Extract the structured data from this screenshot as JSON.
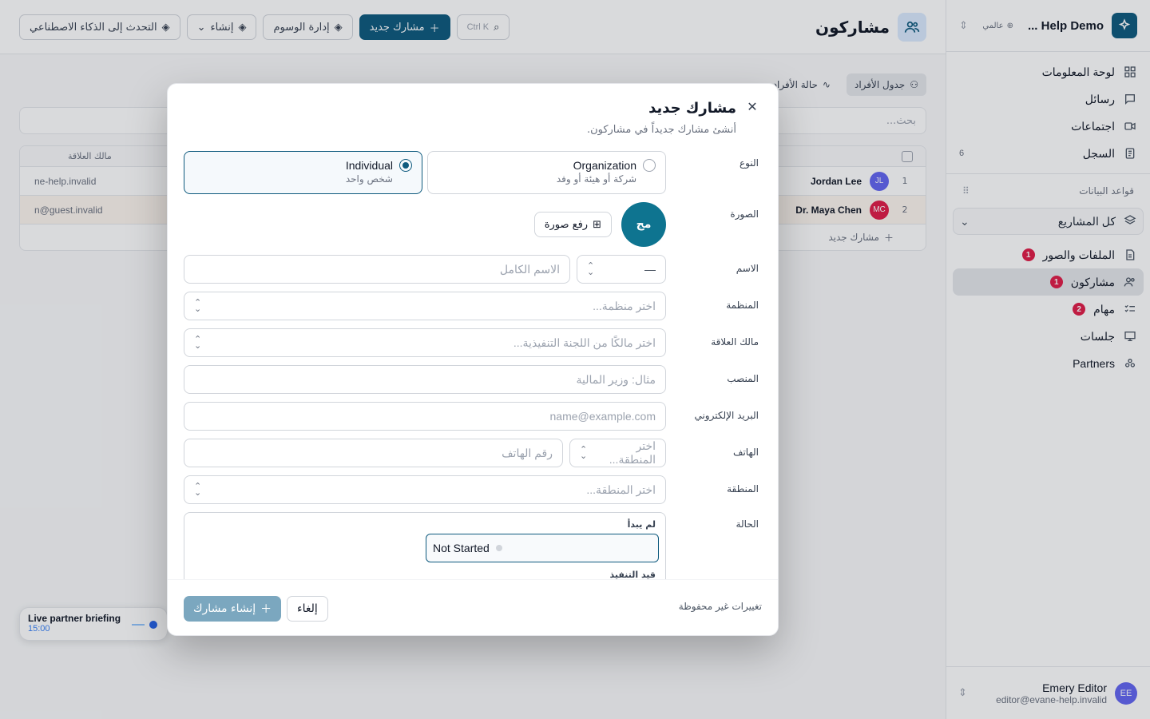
{
  "sidebar": {
    "workspace_name": "Help Demo ...",
    "workspace_scope": "عالمي",
    "nav": [
      {
        "label": "لوحة المعلومات",
        "icon": "dashboard-icon"
      },
      {
        "label": "رسائل",
        "icon": "chat-icon"
      },
      {
        "label": "اجتماعات",
        "icon": "video-icon"
      },
      {
        "label": "السجل",
        "icon": "log-icon",
        "count": "6"
      }
    ],
    "databases_title": "قواعد البيانات",
    "project_selector": "كل المشاريع",
    "db_items": [
      {
        "label": "الملفات والصور",
        "badge": "1"
      },
      {
        "label": "مشاركون",
        "badge": "1"
      },
      {
        "label": "مهام",
        "badge": "2"
      },
      {
        "label": "جلسات",
        "badge": ""
      },
      {
        "label": "Partners",
        "badge": ""
      }
    ],
    "user": {
      "initials": "EE",
      "name": "Emery Editor",
      "email": "editor@evane-help.invalid"
    }
  },
  "topbar": {
    "title": "مشاركون",
    "new_participant": "مشارك جديد",
    "manage_tags": "إدارة الوسوم",
    "create": "إنشاء",
    "ask_ai": "التحدث إلى الذكاء الاصطناعي",
    "shortcut": "Ctrl K"
  },
  "background": {
    "tabs": [
      "جدول الأفراد",
      "حالة الأفراد"
    ],
    "search_placeholder": "بحث...",
    "column_owner": "مالك العلاقة",
    "rows": [
      {
        "num": "1",
        "name": "Jordan Lee",
        "initials": "JL",
        "color": "#6366f1",
        "email": "ne-help.invalid"
      },
      {
        "num": "2",
        "name": "Dr. Maya Chen",
        "initials": "MC",
        "color": "#e11d48",
        "email": "n@guest.invalid"
      }
    ],
    "add_row": "مشارك جديد",
    "live": {
      "title": "Live partner briefing",
      "time": "15:00"
    }
  },
  "modal": {
    "title": "مشارك جديد",
    "subtitle": "أنشئ مشارك جديداً في مشاركون.",
    "labels": {
      "type": "النوع",
      "photo": "الصورة",
      "name": "الاسم",
      "organization": "المنظمة",
      "owner": "مالك العلاقة",
      "position": "المنصب",
      "email": "البريد الإلكتروني",
      "phone": "الهاتف",
      "region": "المنطقة",
      "status": "الحالة"
    },
    "type_options": [
      {
        "name": "Individual",
        "desc": "شخص واحد"
      },
      {
        "name": "Organization",
        "desc": "شركة أو هيئة أو وفد"
      }
    ],
    "avatar_initials": "مج",
    "upload_label": "رفع صورة",
    "title_prefix": "—",
    "placeholders": {
      "full_name": "الاسم الكامل",
      "organization": "اختر منظمة...",
      "owner": "اختر مالكًا من اللجنة التنفيذية...",
      "position": "مثال: وزير المالية",
      "email": "name@example.com",
      "phone_region": "اختر المنطقة...",
      "phone": "رقم الهاتف",
      "region": "اختر المنطقة..."
    },
    "status_groups": [
      "لم يبدأ",
      "قيد التنفيذ"
    ],
    "status_selected": "Not Started",
    "unsaved": "تغييرات غير محفوظة",
    "cancel": "إلغاء",
    "create": "إنشاء مشارك"
  }
}
